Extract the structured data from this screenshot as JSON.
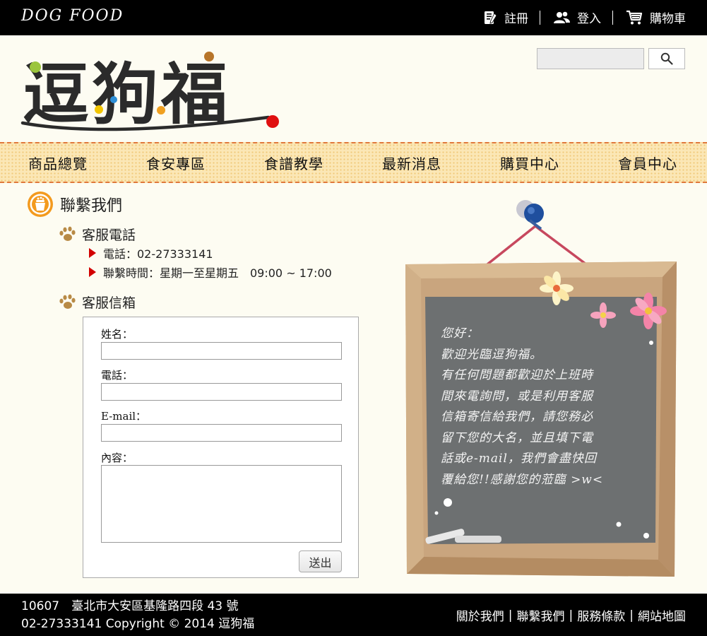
{
  "header": {
    "brand": "DOG  FOOD",
    "links": [
      {
        "label": "註冊",
        "icon": "register-icon"
      },
      {
        "label": "登入",
        "icon": "users-icon"
      },
      {
        "label": "購物車",
        "icon": "cart-icon"
      }
    ]
  },
  "logo": {
    "text": "逗狗福"
  },
  "search": {
    "placeholder": "",
    "button_icon": "search-icon"
  },
  "nav": {
    "items": [
      "商品總覽",
      "食安專區",
      "食譜教學",
      "最新消息",
      "購買中心",
      "會員中心"
    ]
  },
  "contact": {
    "title": "聯繫我們",
    "phone_section": {
      "title": "客服電話",
      "lines": [
        "電話：02-27333141",
        "聯繫時間：星期一至星期五　09:00 ~ 17:00"
      ]
    },
    "mail_section": {
      "title": "客服信箱"
    },
    "form": {
      "name_label": "姓名：",
      "phone_label": "電話：",
      "email_label": "E-mail：",
      "content_label": "內容：",
      "submit_label": "送出"
    }
  },
  "board": {
    "lines": [
      "您好：",
      "歡迎光臨逗狗福。",
      "有任何問題都歡迎於上班時",
      "間來電詢問，或是利用客服",
      "信箱寄信給我們，請您務必",
      "留下您的大名，並且填下電",
      "話或e-mail，我們會盡快回",
      "覆給您!!感謝您的蒞臨 >w<"
    ]
  },
  "footer": {
    "address_line": "10607　臺北市大安區基隆路四段 43 號",
    "copyright_line": "02-27333141  Copyright © 2014 逗狗福",
    "links": [
      "關於我們",
      "聯繫我們",
      "服務條款",
      "網站地圖"
    ],
    "separator": "|"
  },
  "colors": {
    "nav_bg": "#fbe7b6",
    "nav_border": "#e0783a",
    "bullet_red": "#d20000",
    "board_gray": "#6d7071",
    "frame_wood": "#c9a57e",
    "string_red": "#c7485e",
    "title_icon_orange": "#f39a1e"
  }
}
